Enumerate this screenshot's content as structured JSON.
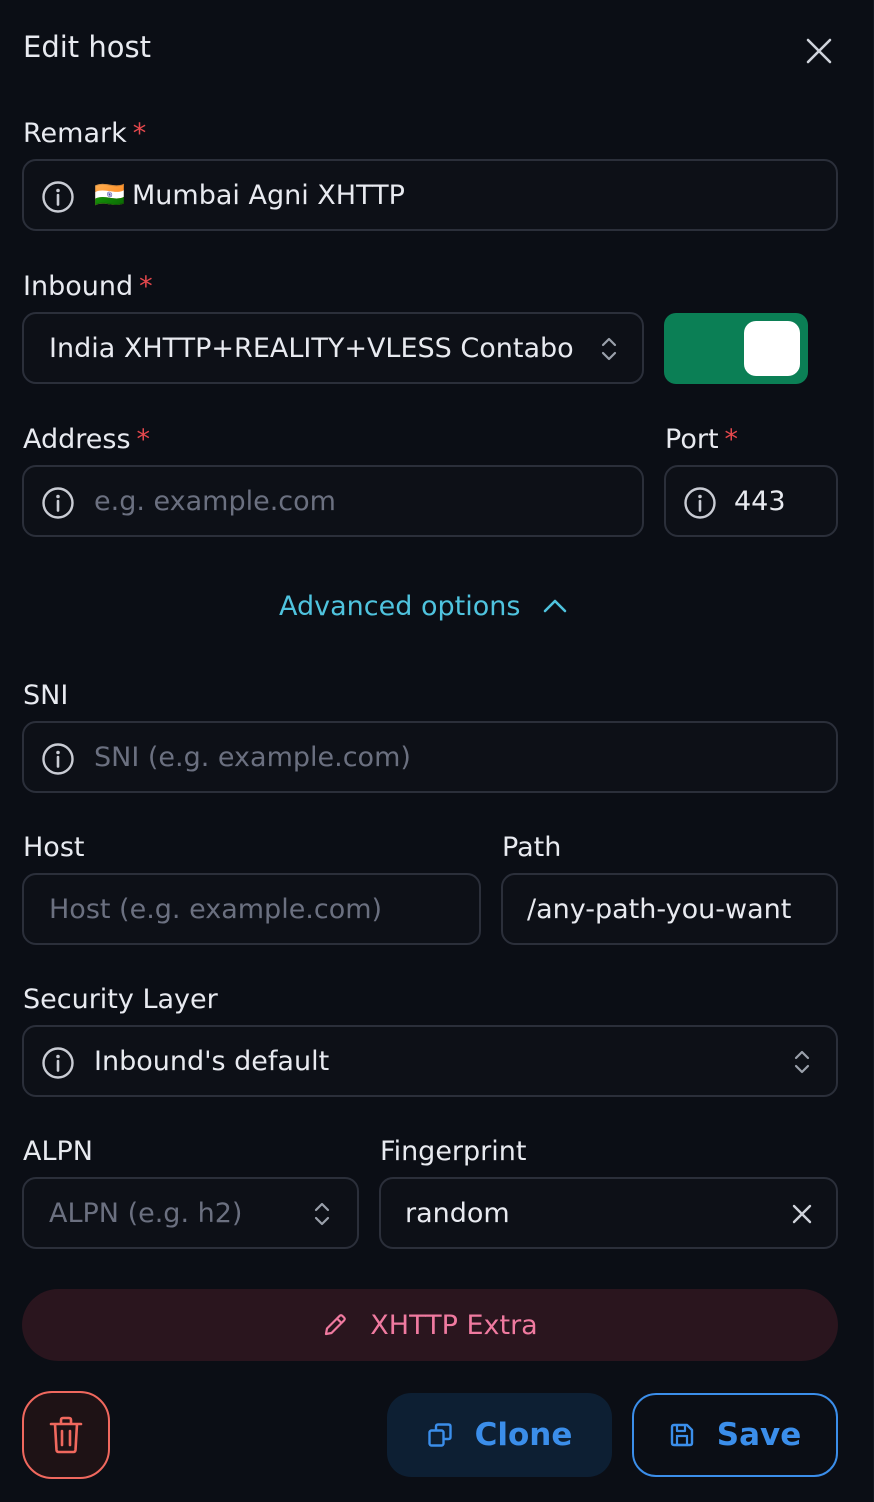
{
  "dialog": {
    "title": "Edit host",
    "close_icon": "close-icon"
  },
  "required_marker": "*",
  "remark": {
    "label": "Remark",
    "flag": "🇮🇳",
    "value": "Mumbai Agni XHTTP"
  },
  "inbound": {
    "label": "Inbound",
    "value": "India XHTTP+REALITY+VLESS Contabo",
    "enabled": true
  },
  "address": {
    "label": "Address",
    "placeholder": "e.g. example.com"
  },
  "port": {
    "label": "Port",
    "value": "443"
  },
  "advanced": {
    "label": "Advanced options",
    "expanded": true
  },
  "sni": {
    "label": "SNI",
    "placeholder": "SNI (e.g. example.com)"
  },
  "host": {
    "label": "Host",
    "placeholder": "Host (e.g. example.com)"
  },
  "path": {
    "label": "Path",
    "value": "/any-path-you-want"
  },
  "security_layer": {
    "label": "Security Layer",
    "value": "Inbound's default"
  },
  "alpn": {
    "label": "ALPN",
    "placeholder": "ALPN (e.g. h2)"
  },
  "fingerprint": {
    "label": "Fingerprint",
    "value": "random"
  },
  "actions": {
    "xhttp_extra": "XHTTP Extra",
    "clone": "Clone",
    "save": "Save"
  },
  "colors": {
    "background": "#0b0e15",
    "border": "#2b2f3a",
    "accent_blue": "#3b8eea",
    "toggle_green": "#0b7f55",
    "link_cyan": "#4fc3de",
    "danger": "#f0685e",
    "pink": "#f07aa0",
    "required": "#e5484d"
  }
}
